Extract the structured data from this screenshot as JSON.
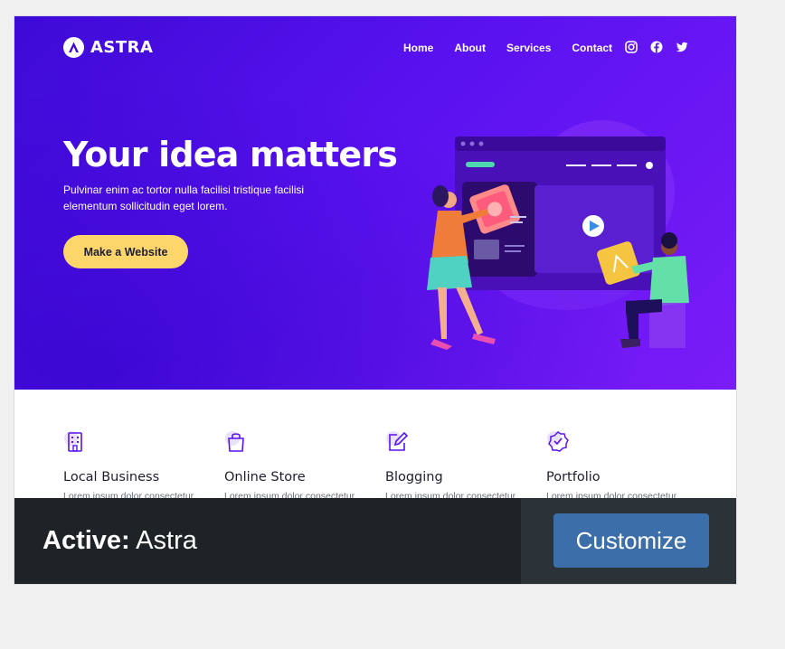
{
  "site": {
    "logo_text": "ASTRA",
    "nav": [
      "Home",
      "About",
      "Services",
      "Contact"
    ],
    "social_icons": [
      "instagram-icon",
      "facebook-icon",
      "twitter-icon"
    ]
  },
  "hero": {
    "title": "Your idea matters",
    "subtitle": "Pulvinar enim ac tortor nulla facilisi tristique facilisi elementum sollicitudin eget lorem.",
    "button_label": "Make a Website",
    "colors": {
      "gradient_start": "#3d0ad6",
      "gradient_end": "#7a1cf7",
      "button": "#fcd56b"
    }
  },
  "features": [
    {
      "icon": "building-icon",
      "title": "Local Business",
      "desc": "Lorem ipsum dolor consectetur"
    },
    {
      "icon": "shopping-bag-icon",
      "title": "Online Store",
      "desc": "Lorem ipsum dolor consectetur"
    },
    {
      "icon": "edit-icon",
      "title": "Blogging",
      "desc": "Lorem ipsum dolor consectetur"
    },
    {
      "icon": "badge-check-icon",
      "title": "Portfolio",
      "desc": "Lorem ipsum dolor consectetur"
    }
  ],
  "theme_bar": {
    "active_label": "Active:",
    "theme_name": "Astra",
    "customize_label": "Customize",
    "colors": {
      "bar": "#1d2327",
      "actions": "#2c3338",
      "button": "#3c6ea9"
    }
  }
}
